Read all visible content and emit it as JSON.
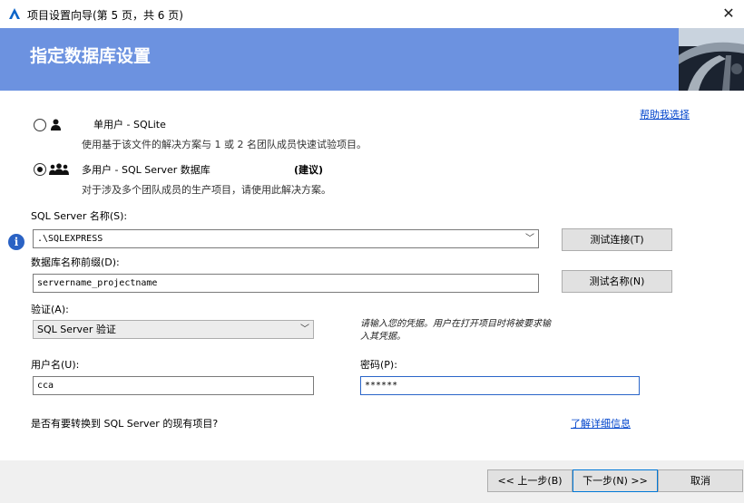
{
  "window": {
    "title": "项目设置向导(第 5 页，共 6 页)",
    "close_glyph": "✕"
  },
  "banner": {
    "title": "指定数据库设置"
  },
  "help_link": "帮助我选择",
  "options": [
    {
      "label": "单用户 - SQLite",
      "desc": "使用基于该文件的解决方案与 1 或 2 名团队成员快速试验项目。",
      "icon": "single-user-icon",
      "selected": false
    },
    {
      "label": "多用户 - SQL Server 数据库",
      "recommend": "(建议)",
      "desc": "对于涉及多个团队成员的生产项目，请使用此解决方案。",
      "icon": "multi-user-icon",
      "selected": true
    }
  ],
  "server": {
    "label": "SQL Server 名称(S):",
    "value": ".\\SQLEXPRESS",
    "test_button": "测试连接(T)"
  },
  "prefix": {
    "label": "数据库名称前缀(D):",
    "value": "servername_projectname",
    "test_button": "测试名称(N)"
  },
  "auth": {
    "label": "验证(A):",
    "value": "SQL Server 验证",
    "note": "请输入您的凭据。用户在打开项目时将被要求输入其凭据。"
  },
  "username": {
    "label": "用户名(U):",
    "value": "cca"
  },
  "password": {
    "label": "密码(P):",
    "value": "******"
  },
  "convert": {
    "question": "是否有要转换到 SQL Server 的现有项目?",
    "link": "了解详细信息"
  },
  "footer": {
    "back": "<< 上一步(B)",
    "next": "下一步(N) >>",
    "cancel": "取消"
  },
  "colors": {
    "banner": "#6c92e0",
    "link": "#0044cc",
    "info": "#2a62c4"
  }
}
